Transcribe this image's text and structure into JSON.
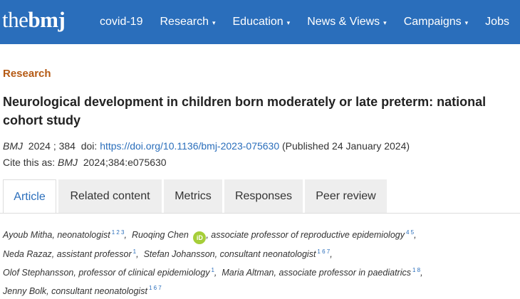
{
  "brand": {
    "logo_thin": "the",
    "logo_bold": "bmj",
    "color": "#2a6ebb"
  },
  "nav": {
    "items": [
      {
        "label": "covid-19",
        "dropdown": false
      },
      {
        "label": "Research",
        "dropdown": true
      },
      {
        "label": "Education",
        "dropdown": true
      },
      {
        "label": "News & Views",
        "dropdown": true
      },
      {
        "label": "Campaigns",
        "dropdown": true
      },
      {
        "label": "Jobs",
        "dropdown": false
      }
    ],
    "chevron": "▾"
  },
  "article": {
    "section": "Research",
    "title": "Neurological development in children born moderately or late preterm: national cohort study",
    "journal": "BMJ",
    "year_volume": "2024 ; 384",
    "doi_label": "doi:",
    "doi_link": "https://doi.org/10.1136/bmj-2023-075630",
    "published": "(Published 24 January 2024)",
    "cite_prefix": "Cite this as:",
    "cite_journal": "BMJ",
    "cite_ref": "2024;384:e075630"
  },
  "tabs": [
    {
      "label": "Article",
      "active": true
    },
    {
      "label": "Related content",
      "active": false
    },
    {
      "label": "Metrics",
      "active": false
    },
    {
      "label": "Responses",
      "active": false
    },
    {
      "label": "Peer review",
      "active": false
    }
  ],
  "authors": [
    {
      "name": "Ayoub Mitha",
      "role": "neonatologist",
      "affil": "1 2 3"
    },
    {
      "name": "Ruoqing Chen",
      "orcid": "iD",
      "role": "associate professor of reproductive epidemiology",
      "affil": "4 5"
    },
    {
      "name": "Neda Razaz",
      "role": "assistant professor",
      "affil": "1"
    },
    {
      "name": "Stefan Johansson",
      "role": "consultant neonatologist",
      "affil": "1 6 7"
    },
    {
      "name": "Olof Stephansson",
      "role": "professor of clinical epidemiology",
      "affil": "1"
    },
    {
      "name": "Maria Altman",
      "role": "associate professor in paediatrics",
      "affil": "1 8"
    },
    {
      "name": "Jenny Bolk",
      "role": "consultant neonatologist",
      "affil": "1 6 7"
    }
  ]
}
